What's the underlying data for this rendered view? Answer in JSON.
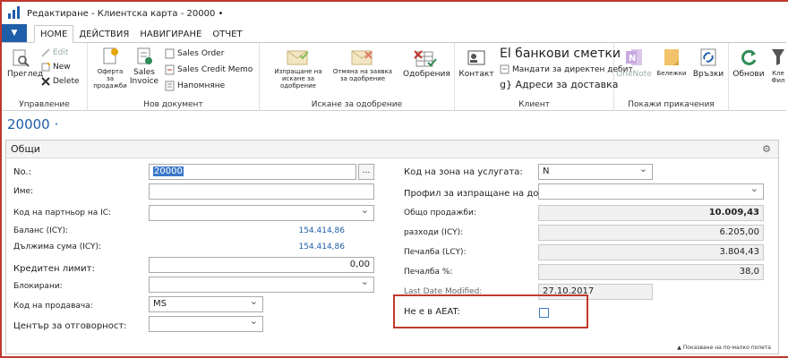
{
  "window": {
    "title": "Редактиране - Клиентска карта - 20000 •"
  },
  "tabs": {
    "menu": "▼",
    "home": "HOME",
    "actions": "ДЕЙСТВИЯ",
    "navigate": "НАВИГИРАНЕ",
    "report": "ОТЧЕТ"
  },
  "ribbon": {
    "manage": {
      "label": "Управление",
      "view": "Преглед",
      "edit": "Edit",
      "new": "New",
      "delete": "Delete"
    },
    "newdoc": {
      "label": "Нов документ",
      "quote": "Оферта за продажби",
      "invoice": "Sales Invoice",
      "order": "Sales Order",
      "credit": "Sales Credit Memo",
      "reminder": "Напомняне"
    },
    "approval": {
      "label": "Искане за одобрение",
      "send": "Изпращане на искане за одобрение",
      "cancel": "Отмяна на заявка за одобрение",
      "approvals": "Одобрения"
    },
    "customer": {
      "label": "Клиент",
      "contact": "Контакт",
      "bank": "El банкови сметки",
      "mandates": "Мандати за директен дебит",
      "addresses": "g} Адреси за доставка"
    },
    "attachments": {
      "label": "Покажи прикачения",
      "onenote": "OneNote",
      "notes": "Бележки",
      "links": "Връзки"
    },
    "refresh": "Обнови",
    "clear": "Кле",
    "clear2": "Фил"
  },
  "page": {
    "id": "20000 ·"
  },
  "section": {
    "title": "Общи",
    "gear": "⚙"
  },
  "left": {
    "no_label": "No.:",
    "no_value": "20000",
    "ellipsis": "...",
    "name_label": "Име:",
    "ic_label": "Код на партньор на IC:",
    "balance_label": "Баланс (ICY):",
    "balance_value": "154.414,86",
    "due_label": "Дължима сума (ICY):",
    "due_value": "154.414,86",
    "credit_label": "Кредитен лимит:",
    "credit_value": "0,00",
    "blocked_label": "Блокирани:",
    "salesperson_label": "Код на продавача:",
    "salesperson_value": "MS",
    "resp_label": "Център за отговорност:"
  },
  "right": {
    "zone_label": "Код на зона на услугата:",
    "zone_value": "N",
    "profile_label": "Профил за изпращане на документи:",
    "sales_label": "Общо продажби:",
    "sales_value": "10.009,43",
    "costs_label": "разходи (ICY):",
    "costs_value": "6.205,00",
    "profit_label": "Печалба (LCY):",
    "profit_value": "3.804,43",
    "profit_pct_label": "Печалба %:",
    "profit_pct_value": "38,0",
    "modified_label": "Last Date Modified:",
    "modified_value": "27.10.2017",
    "aeat_label": "Не е в AEAT:"
  },
  "footer": {
    "note": "Показване на по-малко полета"
  }
}
